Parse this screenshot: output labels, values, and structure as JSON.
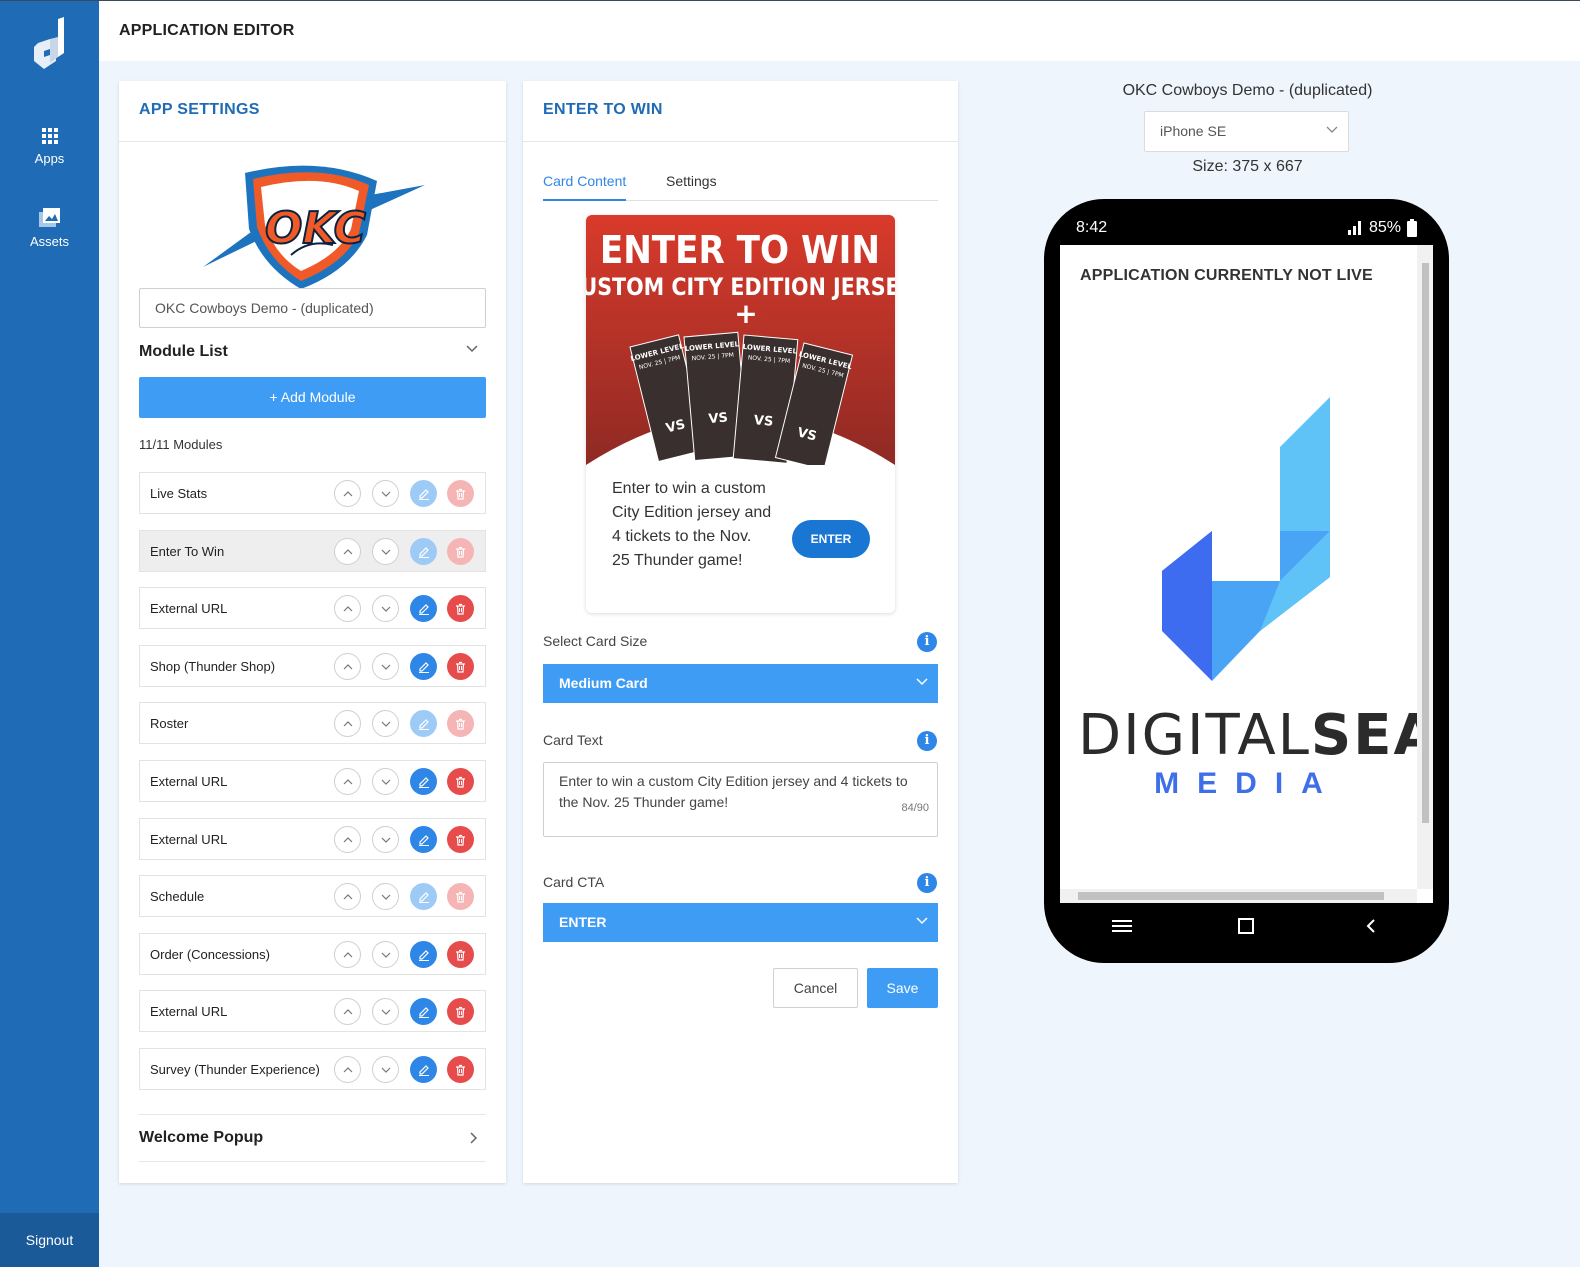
{
  "sidebar": {
    "items": [
      {
        "label": "Apps",
        "icon": "grid-icon"
      },
      {
        "label": "Assets",
        "icon": "image-icon"
      }
    ],
    "signout": "Signout",
    "accent": "#1f6bb5"
  },
  "header": {
    "title": "APPLICATION EDITOR"
  },
  "app_settings": {
    "title": "APP SETTINGS",
    "app_name": "OKC Cowboys Demo - (duplicated)",
    "module_list_title": "Module List",
    "add_module_label": "+ Add Module",
    "module_count": "11/11 Modules",
    "modules": [
      {
        "label": "Live Stats",
        "enabled": false
      },
      {
        "label": "Enter To Win",
        "enabled": false,
        "selected": true
      },
      {
        "label": "External URL",
        "enabled": true
      },
      {
        "label": "Shop (Thunder Shop)",
        "enabled": true
      },
      {
        "label": "Roster",
        "enabled": false
      },
      {
        "label": "External URL",
        "enabled": true
      },
      {
        "label": "External URL",
        "enabled": true
      },
      {
        "label": "Schedule",
        "enabled": false
      },
      {
        "label": "Order (Concessions)",
        "enabled": true
      },
      {
        "label": "External URL",
        "enabled": true
      },
      {
        "label": "Survey (Thunder Experience)",
        "enabled": true
      }
    ],
    "welcome_popup": "Welcome Popup"
  },
  "enter_to_win": {
    "title": "ENTER TO WIN",
    "tabs": [
      "Card Content",
      "Settings"
    ],
    "active_tab": "Card Content",
    "promo": {
      "headline": "ENTER TO WIN",
      "subhead": "CUSTOM CITY EDITION JERSEY",
      "plus": "+",
      "ticket_text": [
        "LOWER LEVEL",
        "NOV. 25 | 7PM",
        "VS"
      ],
      "body": "Enter to win a custom City Edition jersey and 4 tickets to the Nov. 25 Thunder game!",
      "cta": "ENTER"
    },
    "card_size_label": "Select Card Size",
    "card_size_value": "Medium Card",
    "card_text_label": "Card Text",
    "card_text_value": "Enter to win a custom City Edition jersey and 4 tickets to the Nov. 25 Thunder game!",
    "card_text_counter": "84/90",
    "card_cta_label": "Card CTA",
    "card_cta_value": "ENTER",
    "cancel_label": "Cancel",
    "save_label": "Save"
  },
  "preview": {
    "app_name": "OKC Cowboys Demo - (duplicated)",
    "device": "iPhone SE",
    "size": "Size: 375 x 667",
    "time": "8:42",
    "battery": "85%",
    "status_message": "APPLICATION CURRENTLY NOT LIVE",
    "brand_light": "DIGITAL",
    "brand_bold": "SEAT",
    "brand_sub": "MEDIA"
  },
  "colors": {
    "primary_button": "#3f9cf5",
    "edit_button": "#2e86e6",
    "delete_button": "#e64c4c",
    "promo_red": "#d93a2b"
  }
}
